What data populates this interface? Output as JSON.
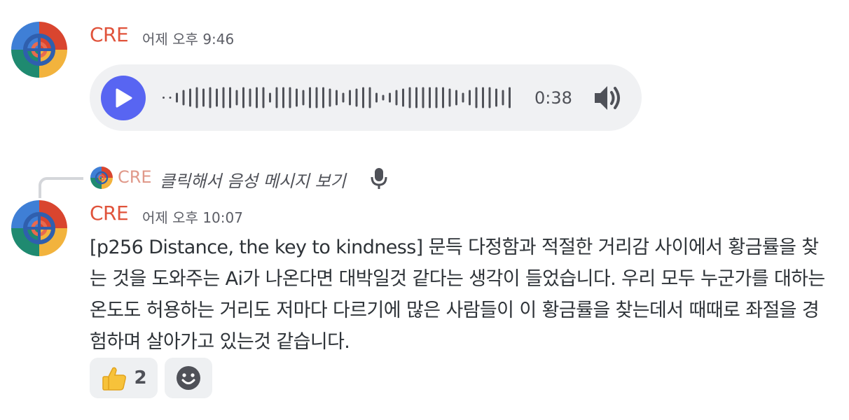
{
  "messages": [
    {
      "author": "CRE",
      "timestamp": "어제 오후 9:46",
      "voice": {
        "duration": "0:38",
        "play_icon": "play-icon",
        "volume_icon": "volume-icon"
      }
    },
    {
      "reply": {
        "author": "CRE",
        "text": "클릭해서 음성 메시지 보기",
        "icon": "microphone-icon"
      },
      "author": "CRE",
      "timestamp": "어제 오후 10:07",
      "content": "[p256 Distance, the key to kindness] 문득 다정함과 적절한 거리감 사이에서 황금률을 찾는 것을 도와주는 Ai가 나온다면 대박일것 같다는 생각이 들었습니다. 우리 모두 누군가를  대하는 온도도 허용하는 거리도 저마다 다르기에 많은 사람들이 이 황금률을 찾는데서 때때로 좌절을 경험하며 살아가고 있는것 같습니다.",
      "reactions": [
        {
          "emoji": "👍",
          "count": "2"
        }
      ],
      "add_reaction_icon": "add-reaction-smiley-icon"
    }
  ],
  "colors": {
    "author": "#e0533b",
    "play_button": "#5865f2",
    "voice_bg": "#f0f1f3",
    "reaction_bg": "#eef0f2"
  }
}
